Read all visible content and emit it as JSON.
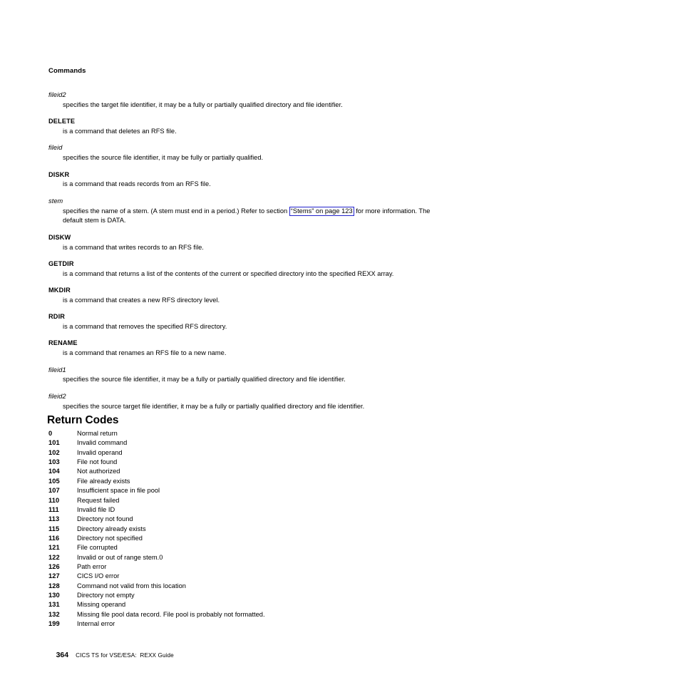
{
  "running_header": "Commands",
  "definitions": [
    {
      "term": "fileid2",
      "style": "italic",
      "definition": "specifies the target file identifier, it may be a fully or partially qualified directory and file identifier."
    },
    {
      "term": "DELETE",
      "style": "bold",
      "definition": "is a command that deletes an RFS file."
    },
    {
      "term": "fileid",
      "style": "italic",
      "definition": "specifies the source file identifier, it may be fully or partially qualified."
    },
    {
      "term": "DISKR",
      "style": "bold",
      "definition": "is a command that reads records from an RFS file."
    },
    {
      "term": "stem",
      "style": "italic",
      "definition_before_link": "specifies the name of a stem. (A stem must end in a period.) Refer to section ",
      "link_text": "“Stems” on page 123",
      "definition_after_link": " for more information. The default stem is DATA."
    },
    {
      "term": "DISKW",
      "style": "bold",
      "definition": "is a command that writes records to an RFS file."
    },
    {
      "term": "GETDIR",
      "style": "bold",
      "definition": "is a command that returns a list of the contents of the current or specified directory into the specified REXX array."
    },
    {
      "term": "MKDIR",
      "style": "bold",
      "definition": "is a command that creates a new RFS directory level."
    },
    {
      "term": "RDIR",
      "style": "bold",
      "definition": "is a command that removes the specified RFS directory."
    },
    {
      "term": "RENAME",
      "style": "bold",
      "definition": "is a command that renames an RFS file to a new name."
    },
    {
      "term": "fileid1",
      "style": "italic",
      "definition": "specifies the source file identifier, it may be a fully or partially qualified directory and file identifier."
    },
    {
      "term": "fileid2",
      "style": "italic",
      "definition": "specifies the source target file identifier, it may be a fully or partially qualified directory and file identifier."
    }
  ],
  "section": {
    "heading": "Return Codes",
    "return_codes": [
      {
        "code": "0",
        "description": "Normal return"
      },
      {
        "code": "101",
        "description": "Invalid command"
      },
      {
        "code": "102",
        "description": "Invalid operand"
      },
      {
        "code": "103",
        "description": "File not found"
      },
      {
        "code": "104",
        "description": "Not authorized"
      },
      {
        "code": "105",
        "description": "File already exists"
      },
      {
        "code": "107",
        "description": "Insufficient space in file pool"
      },
      {
        "code": "110",
        "description": "Request failed"
      },
      {
        "code": "111",
        "description": "Invalid file ID"
      },
      {
        "code": "113",
        "description": "Directory not found"
      },
      {
        "code": "115",
        "description": "Directory already exists"
      },
      {
        "code": "116",
        "description": "Directory not specified"
      },
      {
        "code": "121",
        "description": "File corrupted"
      },
      {
        "code": "122",
        "description": "Invalid or out of range stem.0"
      },
      {
        "code": "126",
        "description": "Path error"
      },
      {
        "code": "127",
        "description": "CICS I/O error"
      },
      {
        "code": "128",
        "description": "Command not valid from this location"
      },
      {
        "code": "130",
        "description": "Directory not empty"
      },
      {
        "code": "131",
        "description": "Missing operand"
      },
      {
        "code": "132",
        "description": "Missing file pool data record. File pool is probably not formatted."
      },
      {
        "code": "199",
        "description": "Internal error"
      }
    ]
  },
  "footer": {
    "page_number": "364",
    "book_title": "CICS TS for VSE/ESA:  REXX Guide"
  },
  "colors": {
    "link_border": "#2222cc",
    "text": "#000000",
    "page_background": "#ffffff"
  }
}
